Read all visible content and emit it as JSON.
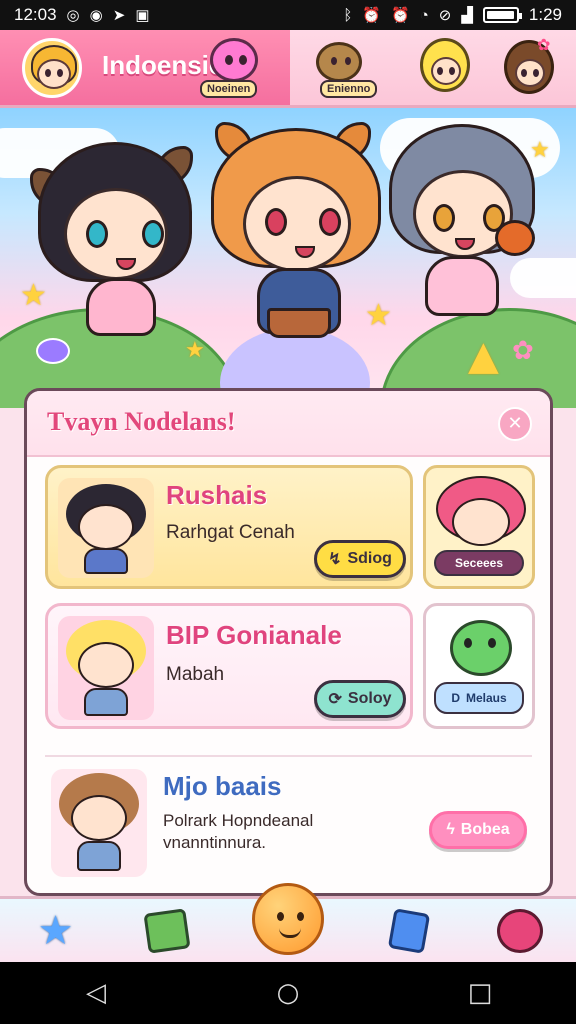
{
  "status_bar": {
    "time_left": "12:03",
    "time_right": "1:29",
    "battery_level": 0.95,
    "icons_left": [
      "instagram-icon",
      "location-icon",
      "navigation-icon",
      "image-icon"
    ],
    "icons_right": [
      "bluetooth-icon",
      "alarm-icon",
      "alarm-icon",
      "wifi-icon",
      "mute-icon",
      "signal-icon",
      "battery-icon"
    ]
  },
  "top_tabs": {
    "title": "Indoensic",
    "tabs": [
      {
        "label": "Noeinen"
      },
      {
        "label": "Enienno"
      }
    ]
  },
  "panel": {
    "title": "Tvayn Nodelans!",
    "close_icon": "close-icon",
    "cards": [
      {
        "title": "Rushais",
        "subtitle": "Rarhgat Cenah",
        "button": "Sdiog",
        "button_icon": "send-icon"
      },
      {
        "title": "BIP Gonianale",
        "subtitle": "Mabah",
        "button": "Soloy",
        "button_icon": "refresh-icon"
      },
      {
        "title": "Mjo baais",
        "subtitle_line1": "Polrark Hopndeanal",
        "subtitle_line2": "vnanntinnura.",
        "button": "Bobea",
        "button_icon": "lightning-icon"
      }
    ],
    "side_cards": [
      {
        "label": "Seceees"
      },
      {
        "label": "Melaus",
        "icon_letter": "D"
      }
    ]
  },
  "bottom_nav": [
    "star-icon",
    "box-icon",
    "home-face-icon",
    "card-icon",
    "profile-icon"
  ],
  "system_nav": {
    "back": "◁",
    "home": "○",
    "recent": "□"
  },
  "colors": {
    "accent_pink": "#f56f9f",
    "accent_yellow": "#ffe48a",
    "accent_teal": "#8ee3cf",
    "panel_border": "#6b4a5a"
  }
}
